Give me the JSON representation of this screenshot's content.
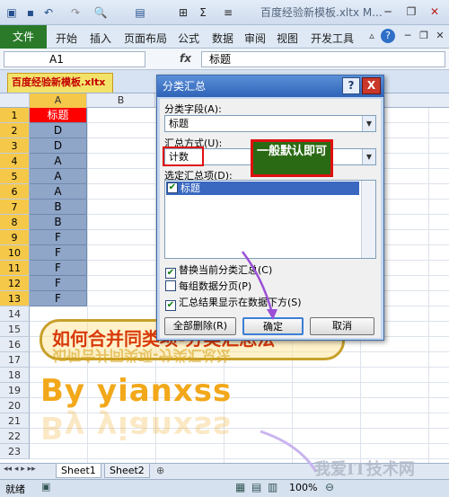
{
  "window": {
    "title": "百度经验新模板.xltx M...",
    "qat_icons": [
      "save-icon",
      "undo-icon",
      "redo-icon",
      "print-preview-icon",
      "paste-format-icon",
      "table-borders-icon",
      "sum-icon",
      "align-icon"
    ]
  },
  "ribbon": {
    "file_tab": "文件",
    "tabs": [
      "开始",
      "插入",
      "页面布局",
      "公式",
      "数据",
      "审阅",
      "视图",
      "开发工具"
    ]
  },
  "formula_bar": {
    "name_box": "A1",
    "fx": "fx",
    "content": "标题"
  },
  "workbook_tab": "百度经验新模板.xltx",
  "grid": {
    "columns": [
      "A",
      "B"
    ],
    "rows": [
      {
        "n": "1",
        "a": "标题"
      },
      {
        "n": "2",
        "a": "D"
      },
      {
        "n": "3",
        "a": "D"
      },
      {
        "n": "4",
        "a": "A"
      },
      {
        "n": "5",
        "a": "A"
      },
      {
        "n": "6",
        "a": "A"
      },
      {
        "n": "7",
        "a": "B"
      },
      {
        "n": "8",
        "a": "B"
      },
      {
        "n": "9",
        "a": "F"
      },
      {
        "n": "10",
        "a": "F"
      },
      {
        "n": "11",
        "a": "F"
      },
      {
        "n": "12",
        "a": "F"
      },
      {
        "n": "13",
        "a": "F"
      },
      {
        "n": "14",
        "a": ""
      },
      {
        "n": "15",
        "a": ""
      },
      {
        "n": "16",
        "a": ""
      },
      {
        "n": "17",
        "a": ""
      },
      {
        "n": "18",
        "a": ""
      },
      {
        "n": "19",
        "a": ""
      },
      {
        "n": "20",
        "a": ""
      },
      {
        "n": "21",
        "a": ""
      },
      {
        "n": "22",
        "a": ""
      },
      {
        "n": "23",
        "a": ""
      }
    ]
  },
  "sheets": [
    "Sheet1",
    "Sheet2"
  ],
  "status": {
    "ready": "就绪",
    "zoom": "100%"
  },
  "dialog": {
    "title": "分类汇总",
    "help": "?",
    "close": "X",
    "field_label": "分类字段(A):",
    "field_value": "标题",
    "method_label": "汇总方式(U):",
    "method_value": "计数",
    "items_label": "选定汇总项(D):",
    "items": [
      "标题"
    ],
    "options": [
      {
        "label": "替换当前分类汇总(C)",
        "checked": true
      },
      {
        "label": "每组数据分页(P)",
        "checked": false
      },
      {
        "label": "汇总结果显示在数据下方(S)",
        "checked": true
      }
    ],
    "remove_all": "全部删除(R)",
    "ok": "确定",
    "cancel": "取消"
  },
  "annotations": {
    "callout": "一般默认即可",
    "banner": "如何合并同类项-分类汇总法",
    "by_line": "By  yianxss",
    "watermark": "我爱IT技术网"
  },
  "colors": {
    "header_cell": "#ff0000",
    "data_cell": "#8fa6c9",
    "callout_bg": "#2b6a14",
    "annotation_red": "#e01010",
    "arrow": "#9b4fd6"
  }
}
